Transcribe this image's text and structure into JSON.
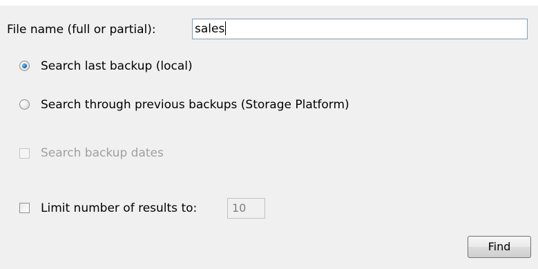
{
  "form": {
    "filename_label": "File name (full or partial):",
    "filename_value": "sales",
    "search_mode": {
      "options": [
        "Search last backup (local)",
        "Search through previous backups (Storage Platform)"
      ],
      "selected": "Search last backup (local)"
    },
    "search_dates_label": "Search backup dates",
    "search_dates_checked": false,
    "search_dates_enabled": false,
    "limit_label": "Limit number of results to:",
    "limit_checked": false,
    "limit_value": "10",
    "find_label": "Find"
  }
}
